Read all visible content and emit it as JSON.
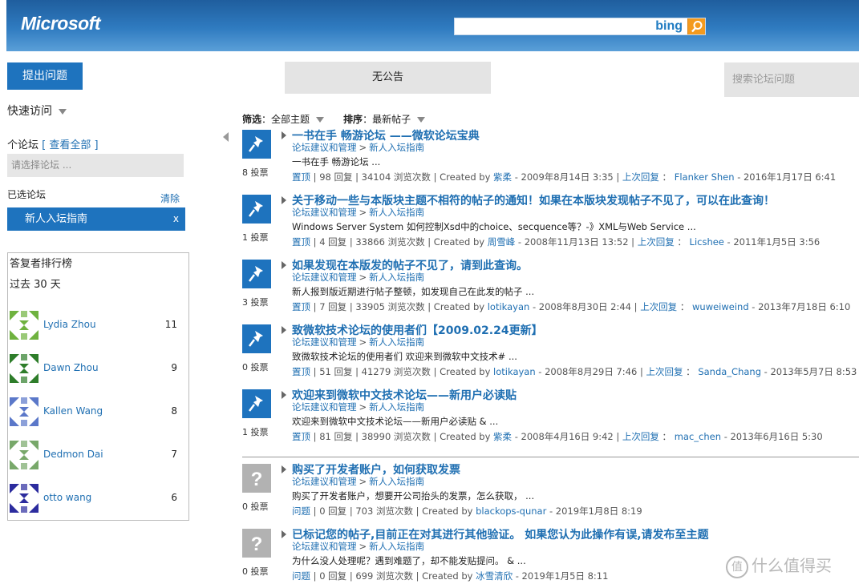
{
  "header": {
    "logo": "Microsoft",
    "search_value": "",
    "bing_label": "bing"
  },
  "left": {
    "ask_button": "提出问题",
    "quick_access": "快速访问",
    "forum_label": "个论坛",
    "view_all": "[ 查看全部 ]",
    "forum_select_placeholder": "请选择论坛 ...",
    "selected_label": "已选论坛",
    "clear_label": "清除",
    "selected_forum": "新人入坛指南",
    "selected_remove": "x",
    "rank": {
      "title": "答复者排行榜",
      "period": "过去 30 天",
      "users": [
        {
          "name": "Lydia Zhou",
          "count": "11",
          "color": "#6fb23f"
        },
        {
          "name": "Dawn Zhou",
          "count": "9",
          "color": "#2e7d2a"
        },
        {
          "name": "Kallen Wang",
          "count": "8",
          "color": "#5b78c9"
        },
        {
          "name": "Dedmon Dai",
          "count": "7",
          "color": "#78a86a"
        },
        {
          "name": "otto wang",
          "count": "6",
          "color": "#2c2c9e"
        }
      ]
    }
  },
  "top": {
    "announcement": "无公告",
    "forum_search_placeholder": "搜索论坛问题"
  },
  "filter": {
    "filter_label": "筛选",
    "filter_value": "全部主题",
    "sort_label": "排序",
    "sort_value": "最新帖子"
  },
  "threads": [
    {
      "type": "pin",
      "votes": "8 投票",
      "title": "一书在手 畅游论坛 ——微软论坛宝典",
      "crumb_a": "论坛建议和管理",
      "crumb_b": "新人入坛指南",
      "snippet": "        一书在手 畅游论坛 ...",
      "status": "置顶",
      "replies": "98 回复",
      "views": "34104 浏览次数",
      "created_prefix": "Created by",
      "author": "紫柔",
      "created_date": "- 2009年8月14日 3:35",
      "last_label": "上次回复",
      "last_user": "Flanker Shen",
      "last_date": "- 2016年1月17日 6:41"
    },
    {
      "type": "pin",
      "votes": "1 投票",
      "title": "关于移动一些与本版块主题不相符的帖子的通知！如果在本版块发现帖子不见了，可以在此查询！",
      "crumb_a": "论坛建议和管理",
      "crumb_b": "新人入坛指南",
      "snippet": "Windows Server System 如何控制Xsd中的choice、secquence等？-》XML与Web Service ...",
      "status": "置顶",
      "replies": "4 回复",
      "views": "33866 浏览次数",
      "created_prefix": "Created by",
      "author": "周雪峰",
      "created_date": "- 2008年11月13日 13:52",
      "last_label": "上次回复",
      "last_user": "Licshee",
      "last_date": "- 2011年1月5日 3:56"
    },
    {
      "type": "pin",
      "votes": "3 投票",
      "title": "如果发现在本版发的帖子不见了，请到此查询。",
      "crumb_a": "论坛建议和管理",
      "crumb_b": "新人入坛指南",
      "snippet": "新人报到版近期进行帖子整顿，如发现自己在此发的帖子 ...",
      "status": "置顶",
      "replies": "7 回复",
      "views": "33905 浏览次数",
      "created_prefix": "Created by",
      "author": "lotikayan",
      "created_date": "- 2008年8月30日 2:44",
      "last_label": "上次回复",
      "last_user": "wuweiweind",
      "last_date": "- 2013年7月18日 6:10"
    },
    {
      "type": "pin",
      "votes": "0 投票",
      "title": "致微软技术论坛的使用者们【2009.02.24更新】",
      "crumb_a": "论坛建议和管理",
      "crumb_b": "新人入坛指南",
      "snippet": "致微软技术论坛的使用者们  欢迎来到微软中文技术# ...",
      "status": "置顶",
      "replies": "51 回复",
      "views": "41279 浏览次数",
      "created_prefix": "Created by",
      "author": "lotikayan",
      "created_date": "- 2008年8月29日 7:46",
      "last_label": "上次回复",
      "last_user": "Sanda_Chang",
      "last_date": "- 2013年5月7日 8:53"
    },
    {
      "type": "pin",
      "votes": "1 投票",
      "title": "欢迎来到微软中文技术论坛——新用户必读贴",
      "crumb_a": "论坛建议和管理",
      "crumb_b": "新人入坛指南",
      "snippet": " 欢迎来到微软中文技术论坛——新用户必读贴   & ...",
      "status": "置顶",
      "replies": "81 回复",
      "views": "38990 浏览次数",
      "created_prefix": "Created by",
      "author": "紫柔",
      "created_date": "- 2008年4月16日 9:42",
      "last_label": "上次回复",
      "last_user": "mac_chen",
      "last_date": "- 2013年6月16日 5:30"
    },
    {
      "type": "q",
      "votes": "0 投票",
      "title": "购买了开发者账户，如何获取发票",
      "crumb_a": "论坛建议和管理",
      "crumb_b": "新人入坛指南",
      "snippet": "购买了开发者账户，想要开公司抬头的发票，怎么获取，  ...",
      "status": "问题",
      "replies": "0 回复",
      "views": "703 浏览次数",
      "created_prefix": "Created by",
      "author": "blackops-qunar",
      "created_date": "- 2019年1月8日 8:19",
      "last_label": "",
      "last_user": "",
      "last_date": ""
    },
    {
      "type": "q",
      "votes": "0 投票",
      "title": "已标记您的帖子,目前正在对其进行其他验证。 如果您认为此操作有误,请发布至主题",
      "crumb_a": "论坛建议和管理",
      "crumb_b": "新人入坛指南",
      "snippet": "为什么没人处理呢？遇到难题了，却不能发贴提问。 & ...",
      "status": "问题",
      "replies": "0 回复",
      "views": "699 浏览次数",
      "created_prefix": "Created by",
      "author": "冰雪清欣",
      "created_date": "- 2019年1月5日 8:11",
      "last_label": "",
      "last_user": "",
      "last_date": ""
    }
  ],
  "watermark": {
    "symbol": "值",
    "text": "什么值得买"
  }
}
